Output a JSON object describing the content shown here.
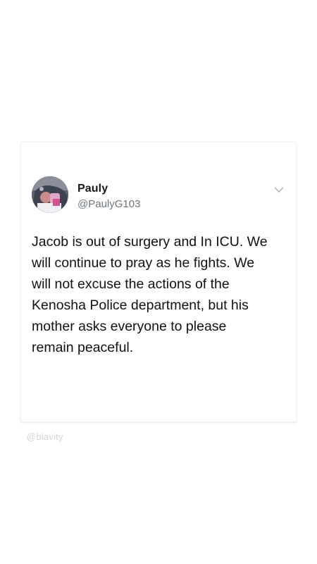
{
  "tweet": {
    "display_name": "Pauly",
    "username": "@PaulyG103",
    "text": "Jacob is out of surgery and In ICU. We\nwill continue to pray as he fights. We\nwill not excuse the actions of the\nKenosha Police department, but his\nmother asks everyone to please\nremain peaceful.",
    "avatar_icon": "profile-photo",
    "menu_icon": "chevron-down-icon"
  },
  "watermark": {
    "text": "@blavity"
  },
  "colors": {
    "background": "#ffffff",
    "text": "#111111",
    "handle": "#6e767d",
    "watermark": "#d4d4d4"
  }
}
